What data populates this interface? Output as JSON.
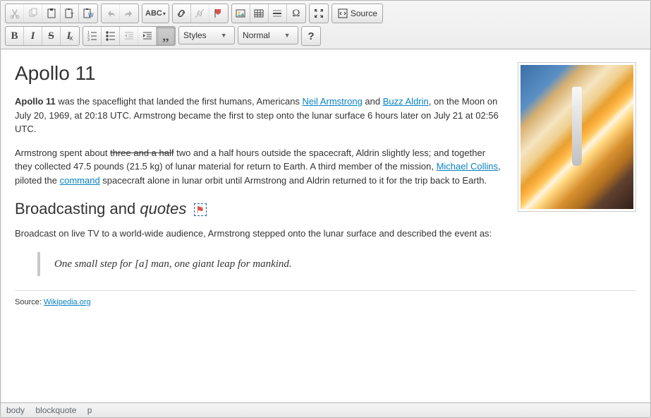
{
  "toolbar": {
    "source_label": "Source",
    "styles_label": "Styles",
    "format_label": "Normal"
  },
  "content": {
    "h1": "Apollo 11",
    "p1": {
      "bold": "Apollo 11",
      "t1": " was the spaceflight that landed the first humans, Americans ",
      "link1": "Neil Armstrong",
      "t2": " and ",
      "link2": "Buzz Aldrin",
      "t3": ", on the Moon on July 20, 1969, at 20:18 UTC. Armstrong became the first to step onto the lunar surface 6 hours later on July 21 at 02:56 UTC."
    },
    "p2": {
      "t1": "Armstrong spent about ",
      "strike": "three and a half",
      "t2": " two and a half hours outside the spacecraft, Aldrin slightly less; and together they collected 47.5 pounds (21.5 kg) of lunar material for return to Earth. A third member of the mission, ",
      "link1": "Michael Collins",
      "t3": ", piloted the ",
      "link2": "command",
      "t4": " spacecraft alone in lunar orbit until Armstrong and Aldrin returned to it for the trip back to Earth."
    },
    "h2_text": "Broadcasting and ",
    "h2_em": "quotes",
    "p3": "Broadcast on live TV to a world-wide audience, Armstrong stepped onto the lunar surface and described the event as:",
    "quote": "One small step for [a] man, one giant leap for mankind.",
    "source_label": "Source: ",
    "source_link": "Wikipedia.org"
  },
  "status": {
    "path1": "body",
    "path2": "blockquote",
    "path3": "p"
  }
}
